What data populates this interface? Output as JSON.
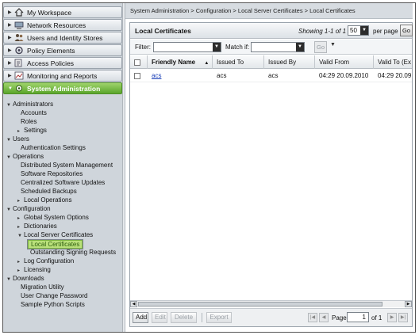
{
  "nav": {
    "drawers": [
      {
        "label": "My Workspace",
        "icon": "workspace-icon"
      },
      {
        "label": "Network Resources",
        "icon": "network-icon"
      },
      {
        "label": "Users and Identity Stores",
        "icon": "users-icon"
      },
      {
        "label": "Policy Elements",
        "icon": "policy-elements-icon"
      },
      {
        "label": "Access Policies",
        "icon": "access-policies-icon"
      },
      {
        "label": "Monitoring and Reports",
        "icon": "monitoring-icon"
      },
      {
        "label": "System Administration",
        "icon": "system-admin-icon"
      }
    ],
    "tree": [
      {
        "label": "Administrators",
        "toggle": "▼"
      },
      {
        "label": "Accounts",
        "toggle": ""
      },
      {
        "label": "Roles",
        "toggle": ""
      },
      {
        "label": "Settings",
        "toggle": "▸"
      },
      {
        "label": "Users",
        "toggle": "▼"
      },
      {
        "label": "Authentication Settings",
        "toggle": ""
      },
      {
        "label": "Operations",
        "toggle": "▼"
      },
      {
        "label": "Distributed System Management",
        "toggle": ""
      },
      {
        "label": "Software Repositories",
        "toggle": ""
      },
      {
        "label": "Centralized Software Updates",
        "toggle": ""
      },
      {
        "label": "Scheduled Backups",
        "toggle": ""
      },
      {
        "label": "Local Operations",
        "toggle": "▸"
      },
      {
        "label": "Configuration",
        "toggle": "▼"
      },
      {
        "label": "Global System Options",
        "toggle": "▸"
      },
      {
        "label": "Dictionaries",
        "toggle": "▸"
      },
      {
        "label": "Local Server Certificates",
        "toggle": "▼"
      },
      {
        "label": "Local Certificates",
        "toggle": ""
      },
      {
        "label": "Outstanding Signing Requests",
        "toggle": ""
      },
      {
        "label": "Log Configuration",
        "toggle": "▸"
      },
      {
        "label": "Licensing",
        "toggle": "▸"
      },
      {
        "label": "Downloads",
        "toggle": "▼"
      },
      {
        "label": "Migration Utility",
        "toggle": ""
      },
      {
        "label": "User Change Password",
        "toggle": ""
      },
      {
        "label": "Sample Python Scripts",
        "toggle": ""
      }
    ]
  },
  "breadcrumb": "System Administration > Configuration > Local Server Certificates > Local Certificates",
  "panel": {
    "title": "Local Certificates",
    "showing": "Showing 1-1 of 1",
    "per_page_value": "50",
    "per_page_label": "per page",
    "go_label": "Go"
  },
  "filter": {
    "filter_label": "Filter:",
    "match_label": "Match if:",
    "go_label": "Go",
    "caret": "▼"
  },
  "table": {
    "columns": [
      "Friendly Name",
      "Issued To",
      "Issued By",
      "Valid From",
      "Valid To (Ex"
    ],
    "sort_indicator": "▲",
    "rows": [
      {
        "friendly_name": "acs",
        "issued_to": "acs",
        "issued_by": "acs",
        "valid_from": "04:29 20.09.2010",
        "valid_to": "04:29 20.09"
      }
    ]
  },
  "toolbar": {
    "add": "Add",
    "edit": "Edit",
    "delete": "Delete",
    "export": "Export",
    "page_label": "Page",
    "page_value": "1",
    "of_label": "of 1"
  },
  "colors": {
    "active_drawer": "#6cb33a",
    "link": "#1a3fb8",
    "selected_tree": "#b9e07a"
  }
}
